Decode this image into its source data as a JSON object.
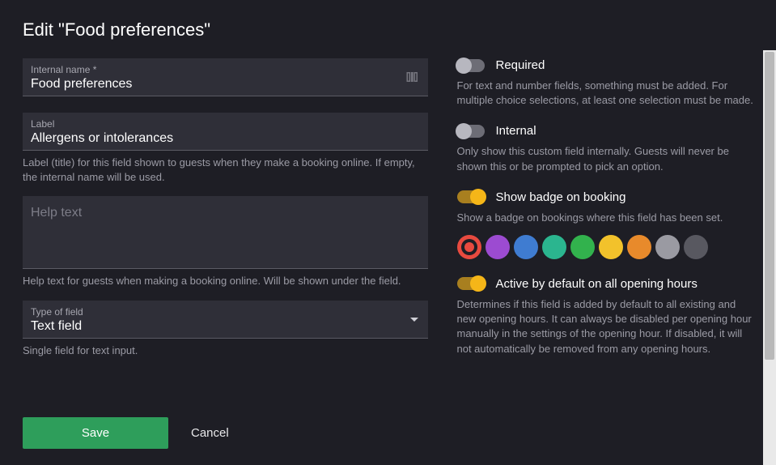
{
  "title": "Edit \"Food preferences\"",
  "left": {
    "internal_name": {
      "label": "Internal name *",
      "value": "Food preferences"
    },
    "label_field": {
      "label": "Label",
      "value": "Allergens or intolerances",
      "help": "Label (title) for this field shown to guests when they make a booking online. If empty, the internal name will be used."
    },
    "help_text": {
      "placeholder": "Help text",
      "value": "",
      "help": "Help text for guests when making a booking online. Will be shown under the field."
    },
    "type_of_field": {
      "label": "Type of field",
      "value": "Text field",
      "help": "Single field for text input."
    }
  },
  "right": {
    "required": {
      "label": "Required",
      "on": false,
      "desc": "For text and number fields, something must be added. For multiple choice selections, at least one selection must be made."
    },
    "internal": {
      "label": "Internal",
      "on": false,
      "desc": "Only show this custom field internally. Guests will never be shown this or be prompted to pick an option."
    },
    "show_badge": {
      "label": "Show badge on booking",
      "on": true,
      "desc": "Show a badge on bookings where this field has been set."
    },
    "badge_colors": [
      {
        "hex": "#e84a3f",
        "selected": true
      },
      {
        "hex": "#9c4bd1",
        "selected": false
      },
      {
        "hex": "#3f7cd1",
        "selected": false
      },
      {
        "hex": "#2bb58f",
        "selected": false
      },
      {
        "hex": "#32b24d",
        "selected": false
      },
      {
        "hex": "#f2c22b",
        "selected": false
      },
      {
        "hex": "#e88a2b",
        "selected": false
      },
      {
        "hex": "#9a9aa2",
        "selected": false
      },
      {
        "hex": "#585860",
        "selected": false
      }
    ],
    "active_default": {
      "label": "Active by default on all opening hours",
      "on": true,
      "desc": "Determines if this field is added by default to all existing and new opening hours. It can always be disabled per opening hour manually in the settings of the opening hour. If disabled, it will not automatically be removed from any opening hours."
    }
  },
  "actions": {
    "save": "Save",
    "cancel": "Cancel"
  }
}
